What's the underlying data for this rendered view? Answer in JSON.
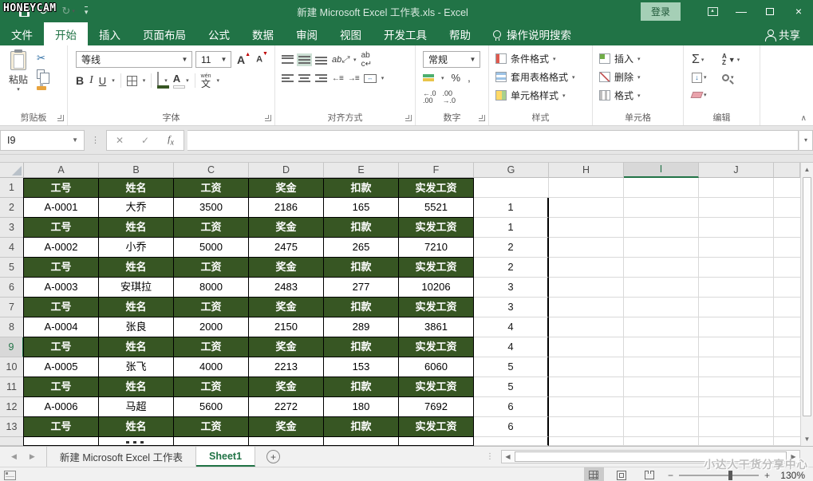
{
  "titlebar": {
    "title": "新建 Microsoft Excel 工作表.xls - Excel",
    "signin": "登录"
  },
  "watermarks": {
    "top_left": "HONEYCAM",
    "bottom_right": "小达人干货分享中心"
  },
  "ribbon_tabs": [
    {
      "label": "文件"
    },
    {
      "label": "开始",
      "active": true
    },
    {
      "label": "插入"
    },
    {
      "label": "页面布局"
    },
    {
      "label": "公式"
    },
    {
      "label": "数据"
    },
    {
      "label": "审阅"
    },
    {
      "label": "视图"
    },
    {
      "label": "开发工具"
    },
    {
      "label": "帮助"
    }
  ],
  "tell_me": {
    "label": "操作说明搜索"
  },
  "share": {
    "label": "共享"
  },
  "ribbon": {
    "clipboard": {
      "label": "剪贴板",
      "paste": "粘贴"
    },
    "font": {
      "label": "字体",
      "name": "等线",
      "size": "11"
    },
    "alignment": {
      "label": "对齐方式"
    },
    "number": {
      "label": "数字",
      "format": "常规"
    },
    "styles": {
      "label": "样式",
      "conditional": "条件格式",
      "table_format": "套用表格格式",
      "cell_styles": "单元格样式"
    },
    "cells": {
      "label": "单元格",
      "insert": "插入",
      "delete": "删除",
      "format": "格式"
    },
    "editing": {
      "label": "编辑"
    }
  },
  "formula_bar": {
    "name_box": "I9",
    "value": ""
  },
  "grid": {
    "col_letters": [
      "A",
      "B",
      "C",
      "D",
      "E",
      "F",
      "G",
      "H",
      "I",
      "J"
    ],
    "selected_col": "I",
    "selected_row": 9,
    "header_cells": [
      "工号",
      "姓名",
      "工资",
      "奖金",
      "扣款",
      "实发工资"
    ],
    "rows": [
      {
        "n": 1,
        "type": "header",
        "g": ""
      },
      {
        "n": 2,
        "type": "data",
        "cells": [
          "A-0001",
          "大乔",
          "3500",
          "2186",
          "165",
          "5521"
        ],
        "g": "1"
      },
      {
        "n": 3,
        "type": "header",
        "g": "1"
      },
      {
        "n": 4,
        "type": "data",
        "cells": [
          "A-0002",
          "小乔",
          "5000",
          "2475",
          "265",
          "7210"
        ],
        "g": "2"
      },
      {
        "n": 5,
        "type": "header",
        "g": "2"
      },
      {
        "n": 6,
        "type": "data",
        "cells": [
          "A-0003",
          "安琪拉",
          "8000",
          "2483",
          "277",
          "10206"
        ],
        "g": "3"
      },
      {
        "n": 7,
        "type": "header",
        "g": "3"
      },
      {
        "n": 8,
        "type": "data",
        "cells": [
          "A-0004",
          "张良",
          "2000",
          "2150",
          "289",
          "3861"
        ],
        "g": "4"
      },
      {
        "n": 9,
        "type": "header",
        "g": "4"
      },
      {
        "n": 10,
        "type": "data",
        "cells": [
          "A-0005",
          "张飞",
          "4000",
          "2213",
          "153",
          "6060"
        ],
        "g": "5"
      },
      {
        "n": 11,
        "type": "header",
        "g": "5"
      },
      {
        "n": 12,
        "type": "data",
        "cells": [
          "A-0006",
          "马超",
          "5600",
          "2272",
          "180",
          "7692"
        ],
        "g": "6"
      },
      {
        "n": 13,
        "type": "header",
        "g": "6"
      }
    ]
  },
  "sheet_tabs": {
    "tab1": "新建 Microsoft Excel 工作表",
    "tab2": "Sheet1"
  },
  "status": {
    "zoom": "130%"
  },
  "colors": {
    "excel_green": "#217346",
    "table_header_green": "#375623"
  }
}
